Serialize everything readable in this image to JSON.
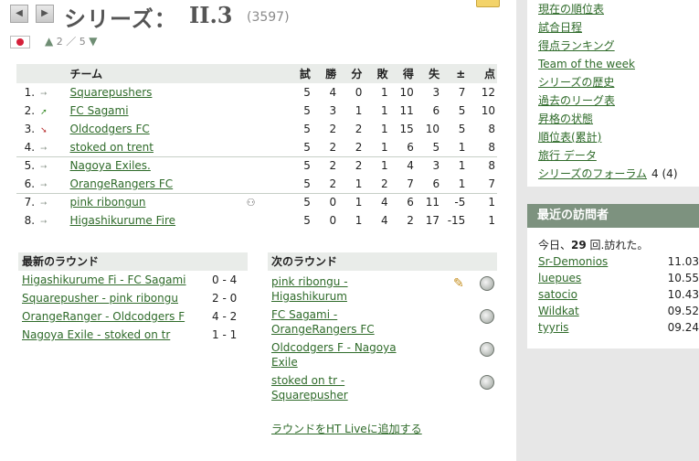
{
  "header": {
    "series_label": "シリーズ：",
    "series_code": "II.3",
    "series_id": "(3597)",
    "level_nav": {
      "current": "2",
      "sep": "／",
      "total": "5"
    }
  },
  "icons": {
    "prev": "left-arrow-icon",
    "next": "right-arrow-icon",
    "flag": "japan-flag-icon",
    "trend_same": "gray-arrow-icon",
    "trend_up": "green-up-arrow-icon",
    "trend_down": "red-down-arrow-icon",
    "match_preview": "magnifier-icon",
    "lineup": "pencil-icon",
    "bot": "person-icon"
  },
  "colors": {
    "accent": "#2f6b2a",
    "header_bg": "#e9ece9",
    "panel_head": "#7d927f"
  },
  "table": {
    "headers": {
      "team": "チーム",
      "played": "試",
      "won": "勝",
      "drawn": "分",
      "lost": "敗",
      "gf": "得",
      "ga": "失",
      "diff": "±",
      "pts": "点"
    },
    "rows": [
      {
        "pos": "1.",
        "trend": "same",
        "team": "Squarepushers",
        "played": "5",
        "won": "4",
        "drawn": "0",
        "lost": "1",
        "gf": "10",
        "ga": "3",
        "diff": "7",
        "pts": "12"
      },
      {
        "pos": "2.",
        "trend": "up",
        "team": "FC Sagami",
        "played": "5",
        "won": "3",
        "drawn": "1",
        "lost": "1",
        "gf": "11",
        "ga": "6",
        "diff": "5",
        "pts": "10"
      },
      {
        "pos": "3.",
        "trend": "down",
        "team": "Oldcodgers FC",
        "played": "5",
        "won": "2",
        "drawn": "2",
        "lost": "1",
        "gf": "15",
        "ga": "10",
        "diff": "5",
        "pts": "8"
      },
      {
        "pos": "4.",
        "trend": "same",
        "team": "stoked on trent",
        "played": "5",
        "won": "2",
        "drawn": "2",
        "lost": "1",
        "gf": "6",
        "ga": "5",
        "diff": "1",
        "pts": "8"
      },
      {
        "pos": "5.",
        "trend": "same",
        "team": "Nagoya Exiles.",
        "played": "5",
        "won": "2",
        "drawn": "2",
        "lost": "1",
        "gf": "4",
        "ga": "3",
        "diff": "1",
        "pts": "8"
      },
      {
        "pos": "6.",
        "trend": "same",
        "team": "OrangeRangers FC",
        "played": "5",
        "won": "2",
        "drawn": "1",
        "lost": "2",
        "gf": "7",
        "ga": "6",
        "diff": "1",
        "pts": "7"
      },
      {
        "pos": "7.",
        "trend": "same",
        "team": "pink ribongun",
        "played": "5",
        "won": "0",
        "drawn": "1",
        "lost": "4",
        "gf": "6",
        "ga": "11",
        "diff": "-5",
        "pts": "1"
      },
      {
        "pos": "8.",
        "trend": "same",
        "team": "Higashikurume Fire",
        "played": "5",
        "won": "0",
        "drawn": "1",
        "lost": "4",
        "gf": "2",
        "ga": "17",
        "diff": "-15",
        "pts": "1"
      }
    ]
  },
  "latest_round": {
    "title": "最新のラウンド",
    "matches": [
      {
        "label": "Higashikurume Fi - FC Sagami",
        "score": "0 - 4"
      },
      {
        "label": "Squarepusher - pink ribongu",
        "score": "2 - 0"
      },
      {
        "label": "OrangeRanger - Oldcodgers F",
        "score": "4 - 2"
      },
      {
        "label": "Nagoya Exile - stoked on tr",
        "score": "1 - 1"
      }
    ]
  },
  "next_round": {
    "title": "次のラウンド",
    "matches": [
      {
        "label": "pink ribongu - Higashikurum"
      },
      {
        "label": "FC Sagami - OrangeRangers FC"
      },
      {
        "label": "Oldcodgers F - Nagoya Exile"
      },
      {
        "label": "stoked on tr - Squarepusher"
      }
    ],
    "add_live": "ラウンドをHT Liveに追加する"
  },
  "sidebar": {
    "links": [
      "現在の順位表",
      "試合日程",
      "得点ランキング",
      "Team of the week",
      "シリーズの歴史",
      "過去のリーグ表",
      "昇格の状態",
      "順位表(累計)",
      "旅行 データ",
      "シリーズのフォーラム"
    ],
    "forum_count": "4 (4)",
    "visitors": {
      "title": "最近の訪問者",
      "summary_prefix": "今日、",
      "summary_count": "29",
      "summary_suffix": " 回.訪れた。",
      "list": [
        {
          "name": "Sr-Demonios",
          "time": "11.03"
        },
        {
          "name": "luepues",
          "time": "10.55"
        },
        {
          "name": "satocio",
          "time": "10.43"
        },
        {
          "name": "Wildkat",
          "time": "09.52"
        },
        {
          "name": "tyyris",
          "time": "09.24"
        }
      ]
    }
  }
}
